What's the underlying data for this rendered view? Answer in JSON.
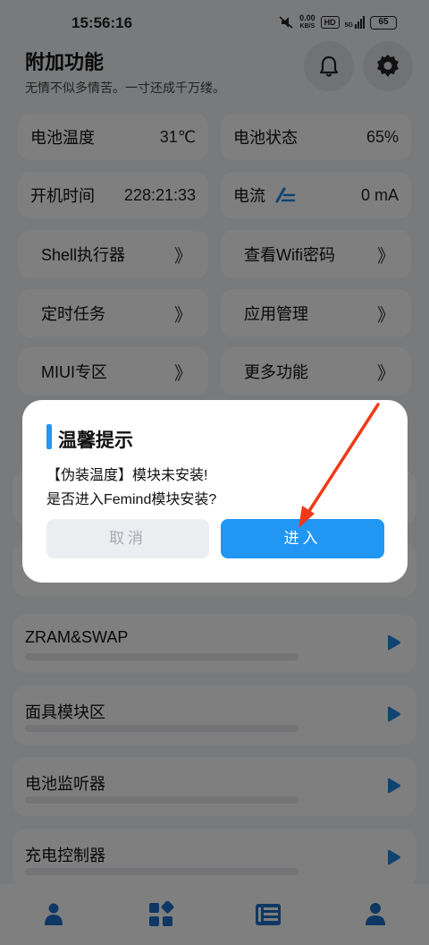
{
  "status_bar": {
    "time": "15:56:16",
    "net_speed_value": "0.00",
    "net_speed_unit": "KB/S",
    "hd_label": "HD",
    "signal_label": "5G",
    "battery": "65"
  },
  "header": {
    "title": "附加功能",
    "subtitle": "无情不似多情苦。一寸还成千万缕。"
  },
  "info_cards": {
    "battery_temp_label": "电池温度",
    "battery_temp_value": "31℃",
    "battery_status_label": "电池状态",
    "battery_status_value": "65%",
    "uptime_label": "开机时间",
    "uptime_value": "228:21:33",
    "current_label": "电流",
    "current_value": "0 mA"
  },
  "feature_buttons": {
    "shell": "Shell执行器",
    "wifi": "查看Wifi密码",
    "timer": "定时任务",
    "apps": "应用管理",
    "miui": "MIUI专区",
    "more": "更多功能",
    "arrow": "》"
  },
  "list_cards": {
    "zram": "ZRAM&SWAP",
    "mask": "面具模块区",
    "battery_monitor": "电池监听器",
    "charge_control": "充电控制器"
  },
  "dialog": {
    "title": "温馨提示",
    "message_line1": "【伪装温度】模块未安装!",
    "message_line2": "是否进入Femind模块安装?",
    "cancel_label": "取消",
    "confirm_label": "进入"
  },
  "colors": {
    "accent": "#2196f3",
    "annotation_arrow": "#f03a17"
  }
}
